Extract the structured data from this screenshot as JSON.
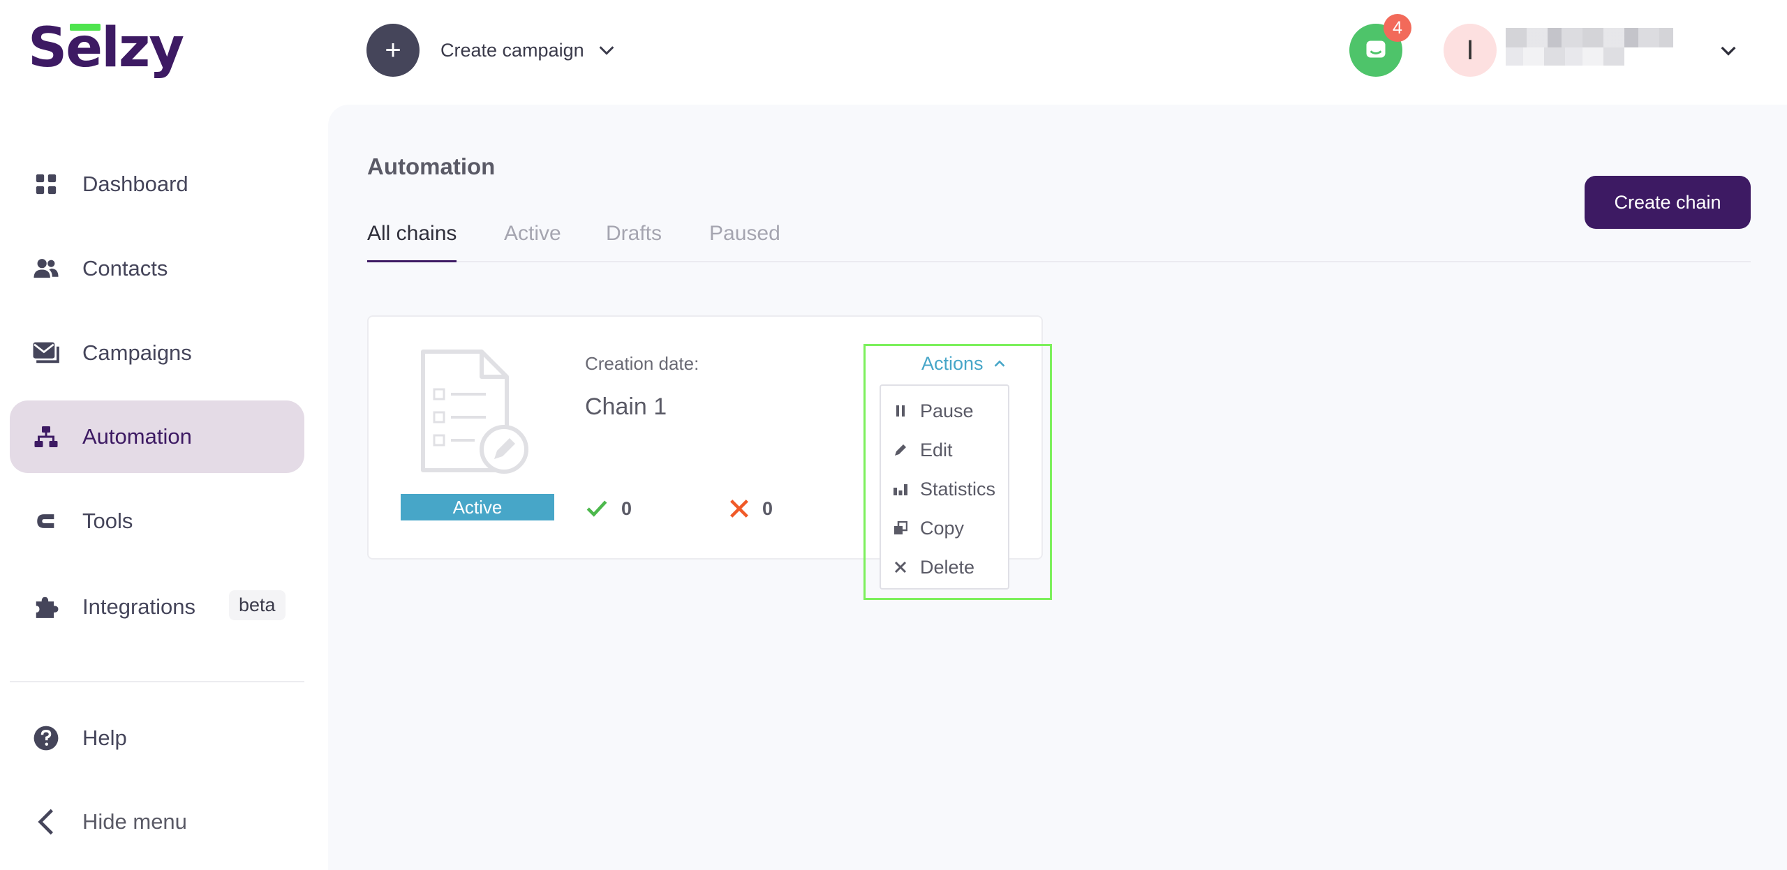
{
  "brand": {
    "logo_text": "Selzy",
    "accent": "#3d1a63",
    "logo_bar_color": "#4ee44e"
  },
  "header": {
    "create_campaign_label": "Create campaign",
    "chat_badge_count": "4",
    "avatar_initial": "I"
  },
  "sidebar": {
    "items": [
      {
        "label": "Dashboard",
        "icon": "dashboard-icon"
      },
      {
        "label": "Contacts",
        "icon": "contacts-icon"
      },
      {
        "label": "Campaigns",
        "icon": "campaigns-icon"
      },
      {
        "label": "Automation",
        "icon": "automation-icon",
        "active": true
      },
      {
        "label": "Tools",
        "icon": "tools-icon"
      },
      {
        "label": "Integrations",
        "icon": "puzzle-icon",
        "badge": "beta"
      }
    ],
    "footer": [
      {
        "label": "Help",
        "icon": "help-icon"
      },
      {
        "label": "Hide menu",
        "icon": "chevron-left-icon"
      }
    ]
  },
  "main": {
    "title": "Automation",
    "create_chain_label": "Create chain",
    "tabs": [
      {
        "label": "All chains",
        "active": true
      },
      {
        "label": "Active"
      },
      {
        "label": "Drafts"
      },
      {
        "label": "Paused"
      }
    ],
    "chain_card": {
      "status": "Active",
      "creation_label": "Creation date:",
      "name": "Chain 1",
      "success_count": "0",
      "error_count": "0",
      "actions_label": "Actions",
      "actions_menu": [
        {
          "label": "Pause",
          "icon": "pause-icon"
        },
        {
          "label": "Edit",
          "icon": "pencil-icon"
        },
        {
          "label": "Statistics",
          "icon": "bar-chart-icon"
        },
        {
          "label": "Copy",
          "icon": "copy-icon"
        },
        {
          "label": "Delete",
          "icon": "close-icon"
        }
      ]
    }
  }
}
